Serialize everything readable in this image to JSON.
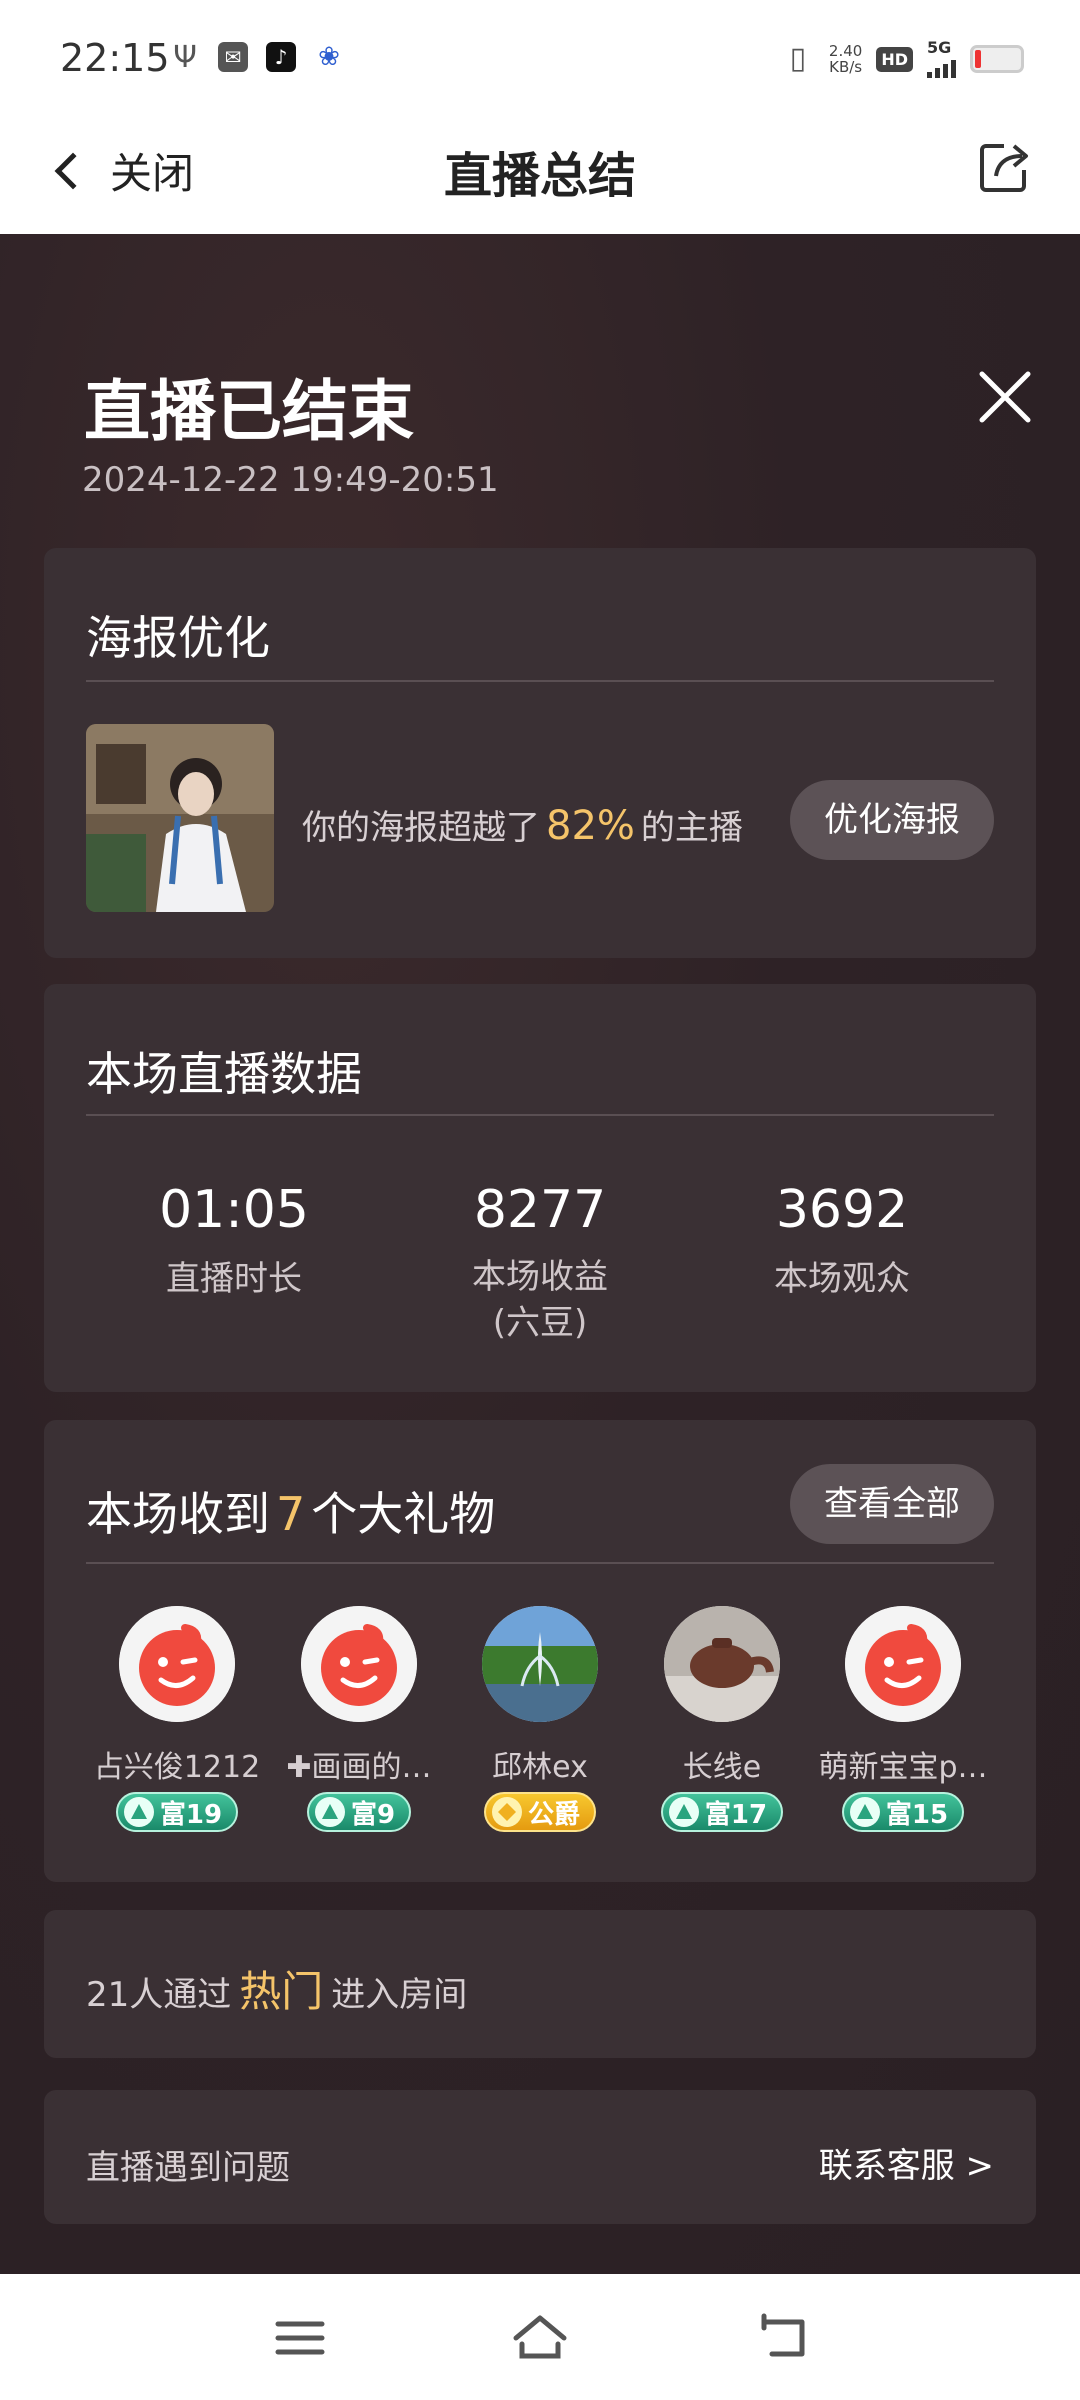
{
  "status_bar": {
    "time": "22:15",
    "net_speed_value": "2.40",
    "net_speed_unit": "KB/s",
    "hd_label": "HD",
    "network_label": "5G"
  },
  "nav": {
    "back_label": "关闭",
    "title": "直播总结"
  },
  "header": {
    "title": "直播已结束",
    "date_range": "2024-12-22 19:49-20:51"
  },
  "poster": {
    "heading": "海报优化",
    "text_before": "你的海报超越了",
    "percent": "82%",
    "text_after": "的主播",
    "button_label": "优化海报"
  },
  "stats": {
    "heading": "本场直播数据",
    "items": [
      {
        "value": "01:05",
        "label": "直播时长",
        "sub": ""
      },
      {
        "value": "8277",
        "label": "本场收益",
        "sub": "(六豆)"
      },
      {
        "value": "3692",
        "label": "本场观众",
        "sub": ""
      }
    ]
  },
  "gifts": {
    "heading_before": "本场收到",
    "count": "7",
    "heading_after": "个大礼物",
    "view_all_label": "查看全部",
    "users": [
      {
        "name": "占兴俊1212",
        "badge": "富19",
        "badge_type": "rich",
        "avatar": "default"
      },
      {
        "name": "✚画画的…",
        "badge": "富9",
        "badge_type": "rich",
        "avatar": "default"
      },
      {
        "name": "邱林ex",
        "badge": "公爵",
        "badge_type": "duke",
        "avatar": "fountain"
      },
      {
        "name": "长线e",
        "badge": "富17",
        "badge_type": "rich",
        "avatar": "teapot"
      },
      {
        "name": "萌新宝宝p…",
        "badge": "富15",
        "badge_type": "rich",
        "avatar": "default"
      }
    ]
  },
  "hot": {
    "before": "21人通过",
    "highlight": "热门",
    "after": "进入房间"
  },
  "support": {
    "issue_label": "直播遇到问题",
    "contact_label": "联系客服 >"
  },
  "colors": {
    "accent_gold": "#f5c46a",
    "card_bg": "#3a3034",
    "page_bg": "#2c2226",
    "rich_badge": "#2aa47e",
    "duke_badge": "#f0b020"
  }
}
